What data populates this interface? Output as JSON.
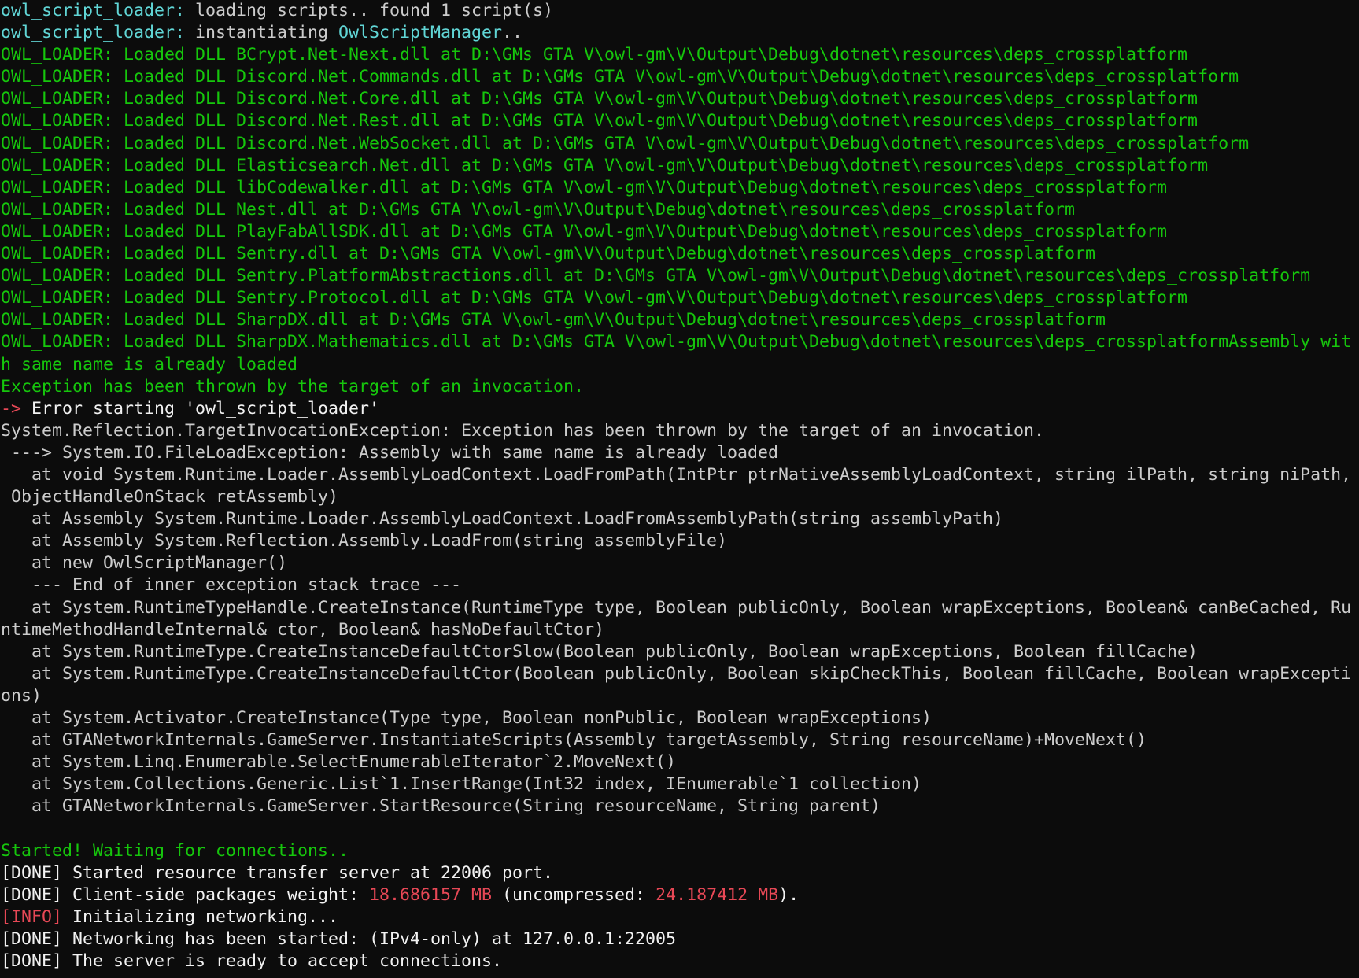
{
  "colors": {
    "background": "#0c0c0c",
    "gray": "#cccccc",
    "cyan": "#61d6d6",
    "green": "#16c60c",
    "red": "#e74856",
    "white": "#f2f2f2"
  },
  "lines": [
    {
      "segs": [
        {
          "t": "owl_script_loader:",
          "c": "cyan"
        },
        {
          "t": " loading scripts.. found 1 script(s)",
          "c": "gray"
        }
      ]
    },
    {
      "segs": [
        {
          "t": "owl_script_loader:",
          "c": "cyan"
        },
        {
          "t": " instantiating ",
          "c": "gray"
        },
        {
          "t": "OwlScriptManager",
          "c": "cyan"
        },
        {
          "t": "..",
          "c": "gray"
        }
      ]
    },
    {
      "segs": [
        {
          "t": "OWL_LOADER: Loaded DLL BCrypt.Net-Next.dll at D:\\GMs GTA V\\owl-gm\\V\\Output\\Debug\\dotnet\\resources\\deps_crossplatform",
          "c": "green"
        }
      ]
    },
    {
      "segs": [
        {
          "t": "OWL_LOADER: Loaded DLL Discord.Net.Commands.dll at D:\\GMs GTA V\\owl-gm\\V\\Output\\Debug\\dotnet\\resources\\deps_crossplatform",
          "c": "green"
        }
      ]
    },
    {
      "segs": [
        {
          "t": "OWL_LOADER: Loaded DLL Discord.Net.Core.dll at D:\\GMs GTA V\\owl-gm\\V\\Output\\Debug\\dotnet\\resources\\deps_crossplatform",
          "c": "green"
        }
      ]
    },
    {
      "segs": [
        {
          "t": "OWL_LOADER: Loaded DLL Discord.Net.Rest.dll at D:\\GMs GTA V\\owl-gm\\V\\Output\\Debug\\dotnet\\resources\\deps_crossplatform",
          "c": "green"
        }
      ]
    },
    {
      "segs": [
        {
          "t": "OWL_LOADER: Loaded DLL Discord.Net.WebSocket.dll at D:\\GMs GTA V\\owl-gm\\V\\Output\\Debug\\dotnet\\resources\\deps_crossplatform",
          "c": "green"
        }
      ]
    },
    {
      "segs": [
        {
          "t": "OWL_LOADER: Loaded DLL Elasticsearch.Net.dll at D:\\GMs GTA V\\owl-gm\\V\\Output\\Debug\\dotnet\\resources\\deps_crossplatform",
          "c": "green"
        }
      ]
    },
    {
      "segs": [
        {
          "t": "OWL_LOADER: Loaded DLL libCodewalker.dll at D:\\GMs GTA V\\owl-gm\\V\\Output\\Debug\\dotnet\\resources\\deps_crossplatform",
          "c": "green"
        }
      ]
    },
    {
      "segs": [
        {
          "t": "OWL_LOADER: Loaded DLL Nest.dll at D:\\GMs GTA V\\owl-gm\\V\\Output\\Debug\\dotnet\\resources\\deps_crossplatform",
          "c": "green"
        }
      ]
    },
    {
      "segs": [
        {
          "t": "OWL_LOADER: Loaded DLL PlayFabAllSDK.dll at D:\\GMs GTA V\\owl-gm\\V\\Output\\Debug\\dotnet\\resources\\deps_crossplatform",
          "c": "green"
        }
      ]
    },
    {
      "segs": [
        {
          "t": "OWL_LOADER: Loaded DLL Sentry.dll at D:\\GMs GTA V\\owl-gm\\V\\Output\\Debug\\dotnet\\resources\\deps_crossplatform",
          "c": "green"
        }
      ]
    },
    {
      "segs": [
        {
          "t": "OWL_LOADER: Loaded DLL Sentry.PlatformAbstractions.dll at D:\\GMs GTA V\\owl-gm\\V\\Output\\Debug\\dotnet\\resources\\deps_crossplatform",
          "c": "green"
        }
      ]
    },
    {
      "segs": [
        {
          "t": "OWL_LOADER: Loaded DLL Sentry.Protocol.dll at D:\\GMs GTA V\\owl-gm\\V\\Output\\Debug\\dotnet\\resources\\deps_crossplatform",
          "c": "green"
        }
      ]
    },
    {
      "segs": [
        {
          "t": "OWL_LOADER: Loaded DLL SharpDX.dll at D:\\GMs GTA V\\owl-gm\\V\\Output\\Debug\\dotnet\\resources\\deps_crossplatform",
          "c": "green"
        }
      ]
    },
    {
      "segs": [
        {
          "t": "OWL_LOADER: Loaded DLL SharpDX.Mathematics.dll at D:\\GMs GTA V\\owl-gm\\V\\Output\\Debug\\dotnet\\resources\\deps_crossplatformAssembly wit",
          "c": "green"
        }
      ]
    },
    {
      "segs": [
        {
          "t": "h same name is already loaded",
          "c": "green"
        }
      ]
    },
    {
      "segs": [
        {
          "t": "Exception has been thrown by the target of an invocation.",
          "c": "green"
        }
      ]
    },
    {
      "segs": [
        {
          "t": "->",
          "c": "red"
        },
        {
          "t": " Error starting 'owl_script_loader'",
          "c": "white"
        }
      ]
    },
    {
      "segs": [
        {
          "t": "System.Reflection.TargetInvocationException: Exception has been thrown by the target of an invocation.",
          "c": "gray"
        }
      ]
    },
    {
      "segs": [
        {
          "t": " ---> System.IO.FileLoadException: Assembly with same name is already loaded",
          "c": "gray"
        }
      ]
    },
    {
      "segs": [
        {
          "t": "   at void System.Runtime.Loader.AssemblyLoadContext.LoadFromPath(IntPtr ptrNativeAssemblyLoadContext, string ilPath, string niPath,",
          "c": "gray"
        }
      ]
    },
    {
      "segs": [
        {
          "t": " ObjectHandleOnStack retAssembly)",
          "c": "gray"
        }
      ]
    },
    {
      "segs": [
        {
          "t": "   at Assembly System.Runtime.Loader.AssemblyLoadContext.LoadFromAssemblyPath(string assemblyPath)",
          "c": "gray"
        }
      ]
    },
    {
      "segs": [
        {
          "t": "   at Assembly System.Reflection.Assembly.LoadFrom(string assemblyFile)",
          "c": "gray"
        }
      ]
    },
    {
      "segs": [
        {
          "t": "   at new OwlScriptManager()",
          "c": "gray"
        }
      ]
    },
    {
      "segs": [
        {
          "t": "   --- End of inner exception stack trace ---",
          "c": "gray"
        }
      ]
    },
    {
      "segs": [
        {
          "t": "   at System.RuntimeTypeHandle.CreateInstance(RuntimeType type, Boolean publicOnly, Boolean wrapExceptions, Boolean& canBeCached, Ru",
          "c": "gray"
        }
      ]
    },
    {
      "segs": [
        {
          "t": "ntimeMethodHandleInternal& ctor, Boolean& hasNoDefaultCtor)",
          "c": "gray"
        }
      ]
    },
    {
      "segs": [
        {
          "t": "   at System.RuntimeType.CreateInstanceDefaultCtorSlow(Boolean publicOnly, Boolean wrapExceptions, Boolean fillCache)",
          "c": "gray"
        }
      ]
    },
    {
      "segs": [
        {
          "t": "   at System.RuntimeType.CreateInstanceDefaultCtor(Boolean publicOnly, Boolean skipCheckThis, Boolean fillCache, Boolean wrapExcepti",
          "c": "gray"
        }
      ]
    },
    {
      "segs": [
        {
          "t": "ons)",
          "c": "gray"
        }
      ]
    },
    {
      "segs": [
        {
          "t": "   at System.Activator.CreateInstance(Type type, Boolean nonPublic, Boolean wrapExceptions)",
          "c": "gray"
        }
      ]
    },
    {
      "segs": [
        {
          "t": "   at GTANetworkInternals.GameServer.InstantiateScripts(Assembly targetAssembly, String resourceName)+MoveNext()",
          "c": "gray"
        }
      ]
    },
    {
      "segs": [
        {
          "t": "   at System.Linq.Enumerable.SelectEnumerableIterator`2.MoveNext()",
          "c": "gray"
        }
      ]
    },
    {
      "segs": [
        {
          "t": "   at System.Collections.Generic.List`1.InsertRange(Int32 index, IEnumerable`1 collection)",
          "c": "gray"
        }
      ]
    },
    {
      "segs": [
        {
          "t": "   at GTANetworkInternals.GameServer.StartResource(String resourceName, String parent)",
          "c": "gray"
        }
      ]
    },
    {
      "segs": []
    },
    {
      "segs": [
        {
          "t": "Started! Waiting for connections..",
          "c": "green"
        }
      ]
    },
    {
      "segs": [
        {
          "t": "[DONE] Started resource transfer server at 22006 port.",
          "c": "white"
        }
      ]
    },
    {
      "segs": [
        {
          "t": "[DONE] Client-side packages weight: ",
          "c": "white"
        },
        {
          "t": "18.686157 MB",
          "c": "red"
        },
        {
          "t": " (uncompressed: ",
          "c": "white"
        },
        {
          "t": "24.187412 MB",
          "c": "red"
        },
        {
          "t": ").",
          "c": "white"
        }
      ]
    },
    {
      "segs": [
        {
          "t": "[INFO]",
          "c": "red"
        },
        {
          "t": " Initializing networking...",
          "c": "white"
        }
      ]
    },
    {
      "segs": [
        {
          "t": "[DONE] Networking has been started: (IPv4-only) at 127.0.0.1:22005",
          "c": "white"
        }
      ]
    },
    {
      "segs": [
        {
          "t": "[DONE] The server is ready to accept connections.",
          "c": "white"
        }
      ]
    }
  ]
}
